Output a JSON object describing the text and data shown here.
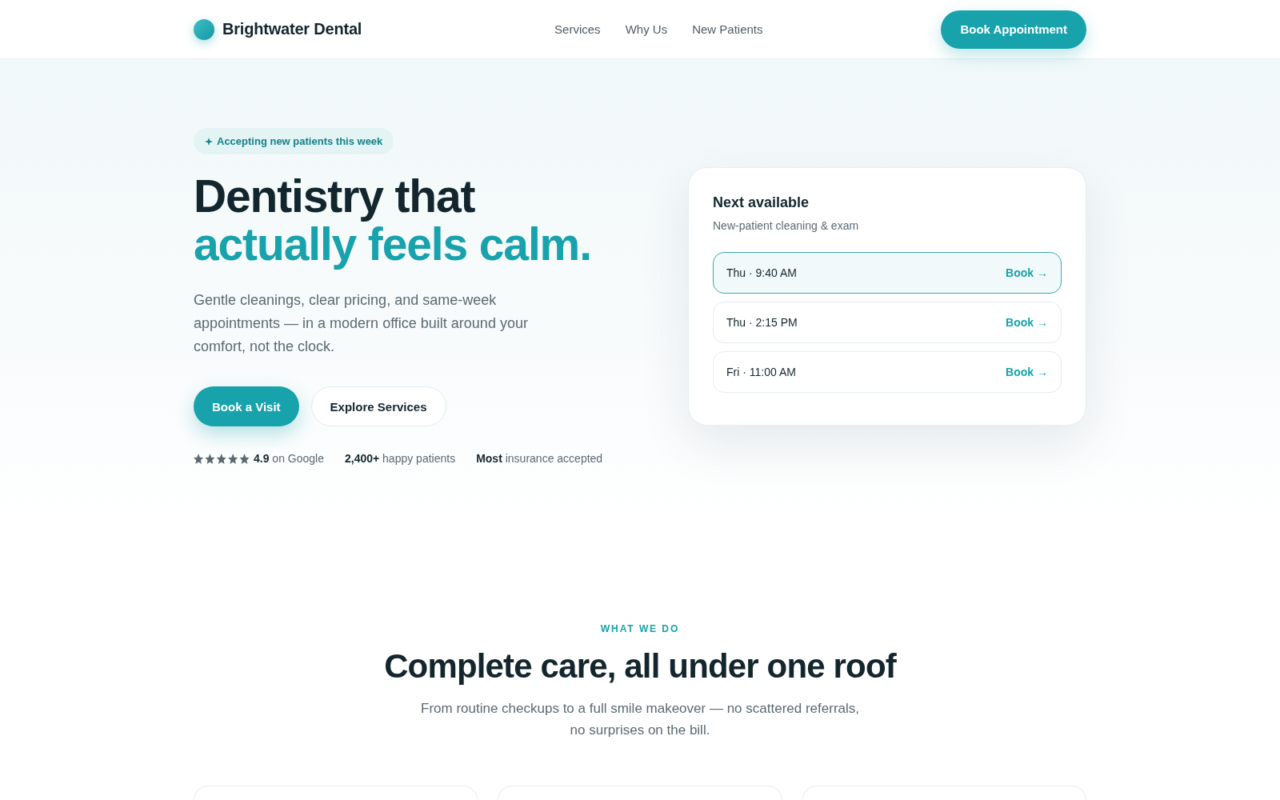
{
  "header": {
    "brand": "Brightwater Dental",
    "nav": [
      {
        "label": "Services"
      },
      {
        "label": "Why Us"
      },
      {
        "label": "New Patients"
      }
    ],
    "cta": "Book Appointment"
  },
  "hero": {
    "badge": "Accepting new patients this week",
    "headline": [
      {
        "text": "Dentistry that",
        "accent": false
      },
      {
        "text": "actually feels calm.",
        "accent": true
      }
    ],
    "description": "Gentle cleanings, clear pricing, and same-week appointments — in a modern office built around your comfort, not the clock.",
    "buttons": [
      {
        "label": "Book a Visit",
        "kind": "primary"
      },
      {
        "label": "Explore Services",
        "kind": "secondary"
      }
    ],
    "stats": [
      {
        "kind": "rating",
        "stars": 5,
        "text": "**4.9** on Google"
      },
      {
        "kind": "plain",
        "text": "**2,400+** happy patients"
      },
      {
        "kind": "plain",
        "text": "**Most** insurance accepted"
      }
    ]
  },
  "availability_card": {
    "title": "Next available",
    "subtitle": "New-patient cleaning & exam",
    "slots": [
      {
        "time": "Thu · 9:40 AM",
        "action": "Book →",
        "selected": true
      },
      {
        "time": "Thu · 2:15 PM",
        "action": "Book →",
        "selected": false
      },
      {
        "time": "Fri · 11:00 AM",
        "action": "Book →",
        "selected": false
      }
    ]
  },
  "services_section": {
    "eyebrow": "WHAT WE DO",
    "title": "Complete care, all under one roof",
    "description": "From routine checkups to a full smile makeover — no scattered referrals, no surprises on the bill."
  }
}
